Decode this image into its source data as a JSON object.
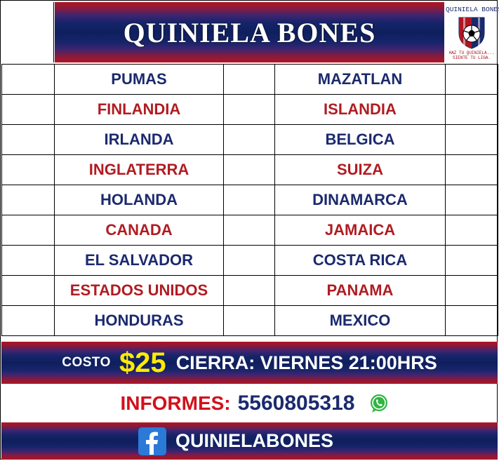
{
  "header": {
    "title": "QUINIELA BONES"
  },
  "logo": {
    "top_text": "QUINIELA BONES",
    "bottom_text_1": "HAZ TU QUINIELA...",
    "bottom_text_2": "SIENTE TU LIGA."
  },
  "matches": [
    {
      "home": "PUMAS",
      "away": "MAZATLAN",
      "color": "blue"
    },
    {
      "home": "FINLANDIA",
      "away": "ISLANDIA",
      "color": "red"
    },
    {
      "home": "IRLANDA",
      "away": "BELGICA",
      "color": "blue"
    },
    {
      "home": "INGLATERRA",
      "away": "SUIZA",
      "color": "red"
    },
    {
      "home": "HOLANDA",
      "away": "DINAMARCA",
      "color": "blue"
    },
    {
      "home": "CANADA",
      "away": "JAMAICA",
      "color": "red"
    },
    {
      "home": "EL SALVADOR",
      "away": "COSTA RICA",
      "color": "blue"
    },
    {
      "home": "ESTADOS UNIDOS",
      "away": "PANAMA",
      "color": "red"
    },
    {
      "home": "HONDURAS",
      "away": "MEXICO",
      "color": "blue"
    }
  ],
  "costo": {
    "label": "COSTO",
    "price": "$25",
    "closing": "CIERRA: VIERNES 21:00HRS"
  },
  "informes": {
    "label": "INFORMES:",
    "phone": "5560805318",
    "icon": "whatsapp-icon"
  },
  "footer": {
    "handle": "QUINIELABONES",
    "icon": "facebook-icon"
  },
  "colors": {
    "blue": "#1b2a6e",
    "red": "#b01c22",
    "yellow": "#ffeb00",
    "band_dark": "#0e1f5c",
    "band_red": "#b01522"
  }
}
